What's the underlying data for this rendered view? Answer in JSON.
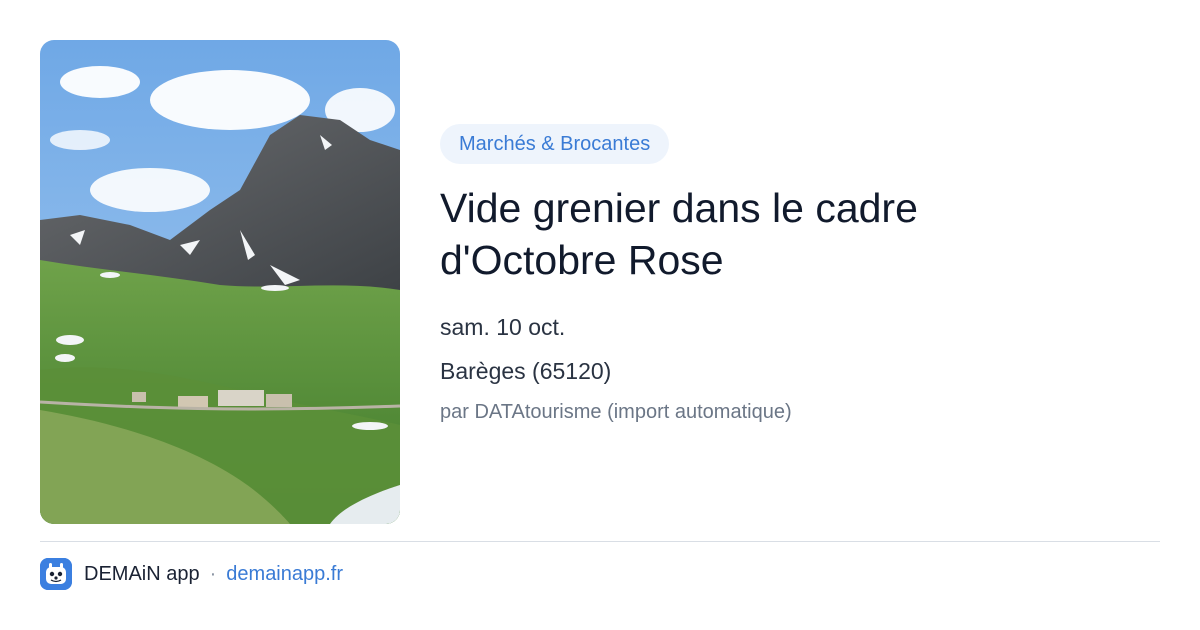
{
  "event": {
    "category": "Marchés & Brocantes",
    "title": "Vide grenier dans le cadre d'Octobre Rose",
    "date": "sam. 10 oct.",
    "location": "Barèges (65120)",
    "author": "par DATAtourisme (import automatique)"
  },
  "footer": {
    "app_name": "DEMAiN app",
    "separator": "·",
    "site": "demainapp.fr"
  },
  "colors": {
    "accent": "#3a7bd5",
    "badge_bg": "#eef4fc",
    "title": "#111a2c",
    "muted": "#6b7686"
  },
  "icons": {
    "app": "demain-app-icon"
  }
}
